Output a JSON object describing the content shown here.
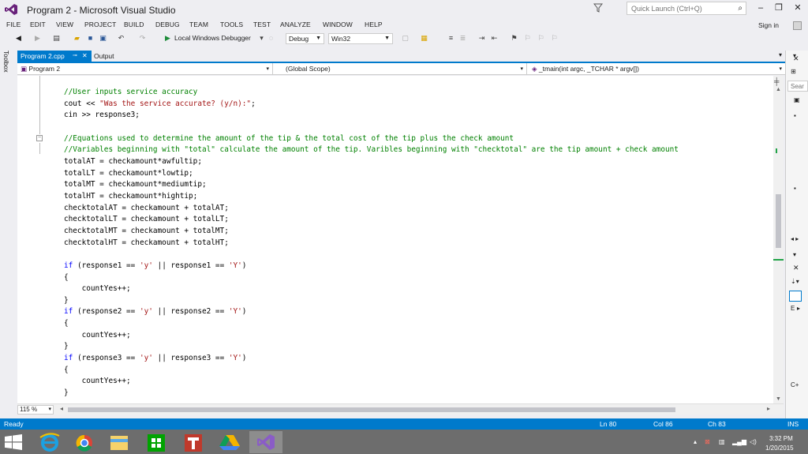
{
  "window": {
    "title": "Program 2 - Microsoft Visual Studio",
    "quick_launch_placeholder": "Quick Launch (Ctrl+Q)",
    "sign_in": "Sign in"
  },
  "menu": [
    "FILE",
    "EDIT",
    "VIEW",
    "PROJECT",
    "BUILD",
    "DEBUG",
    "TEAM",
    "TOOLS",
    "TEST",
    "ANALYZE",
    "WINDOW",
    "HELP"
  ],
  "toolbar": {
    "run_label": "Local Windows Debugger",
    "configuration": "Debug",
    "platform": "Win32"
  },
  "toolbox_label": "Toolbox",
  "tabs": {
    "active": "Program 2.cpp",
    "secondary": "Output"
  },
  "navigation": {
    "project": "Program 2",
    "scope": "(Global Scope)",
    "member": "_tmain(int argc, _TCHAR * argv[])"
  },
  "code_lines": [
    [
      {
        "t": "//User inputs service accuracy",
        "c": "cmt"
      }
    ],
    [
      {
        "t": "cout << ",
        "c": ""
      },
      {
        "t": "\"Was the service accurate? (y/n):\"",
        "c": "str"
      },
      {
        "t": ";",
        "c": ""
      }
    ],
    [
      {
        "t": "cin >> response3;",
        "c": ""
      }
    ],
    [],
    [
      {
        "t": "//Equations used to determine the amount of the tip & the total cost of the tip plus the check amount",
        "c": "cmt"
      }
    ],
    [
      {
        "t": "//Variables beginning with \"total\" calculate the amount of the tip. Varibles beginning with \"checktotal\" are the tip amount + check amount",
        "c": "cmt"
      }
    ],
    [
      {
        "t": "totalAT = checkamount*awfultip;",
        "c": ""
      }
    ],
    [
      {
        "t": "totalLT = checkamount*lowtip;",
        "c": ""
      }
    ],
    [
      {
        "t": "totalMT = checkamount*mediumtip;",
        "c": ""
      }
    ],
    [
      {
        "t": "totalHT = checkamount*hightip;",
        "c": ""
      }
    ],
    [
      {
        "t": "checktotalAT = checkamount + totalAT;",
        "c": ""
      }
    ],
    [
      {
        "t": "checktotalLT = checkamount + totalLT;",
        "c": ""
      }
    ],
    [
      {
        "t": "checktotalMT = checkamount + totalMT;",
        "c": ""
      }
    ],
    [
      {
        "t": "checktotalHT = checkamount + totalHT;",
        "c": ""
      }
    ],
    [],
    [
      {
        "t": "if",
        "c": "kw"
      },
      {
        "t": " (response1 == ",
        "c": ""
      },
      {
        "t": "'y'",
        "c": "str"
      },
      {
        "t": " || response1 == ",
        "c": ""
      },
      {
        "t": "'Y'",
        "c": "str"
      },
      {
        "t": ")",
        "c": ""
      }
    ],
    [
      {
        "t": "{",
        "c": ""
      }
    ],
    [
      {
        "t": "    countYes++;",
        "c": ""
      }
    ],
    [
      {
        "t": "}",
        "c": ""
      }
    ],
    [
      {
        "t": "if",
        "c": "kw"
      },
      {
        "t": " (response2 == ",
        "c": ""
      },
      {
        "t": "'y'",
        "c": "str"
      },
      {
        "t": " || response2 == ",
        "c": ""
      },
      {
        "t": "'Y'",
        "c": "str"
      },
      {
        "t": ")",
        "c": ""
      }
    ],
    [
      {
        "t": "{",
        "c": ""
      }
    ],
    [
      {
        "t": "    countYes++;",
        "c": ""
      }
    ],
    [
      {
        "t": "}",
        "c": ""
      }
    ],
    [
      {
        "t": "if",
        "c": "kw"
      },
      {
        "t": " (response3 == ",
        "c": ""
      },
      {
        "t": "'y'",
        "c": "str"
      },
      {
        "t": " || response3 == ",
        "c": ""
      },
      {
        "t": "'Y'",
        "c": "str"
      },
      {
        "t": ")",
        "c": ""
      }
    ],
    [
      {
        "t": "{",
        "c": ""
      }
    ],
    [
      {
        "t": "    countYes++;",
        "c": ""
      }
    ],
    [
      {
        "t": "}",
        "c": ""
      }
    ]
  ],
  "zoom": "115 %",
  "right_panel": {
    "search_placeholder": "Sear",
    "label_e": "E",
    "label_c": "C+"
  },
  "status": {
    "state": "Ready",
    "line": "Ln 80",
    "col": "Col 86",
    "ch": "Ch 83",
    "mode": "INS"
  },
  "taskbar": {
    "time": "3:32 PM",
    "date": "1/20/2015"
  },
  "colors": {
    "accent": "#007acc",
    "comment": "#008000",
    "string": "#a31515",
    "keyword": "#0000ff",
    "vs_purple": "#68217a"
  }
}
